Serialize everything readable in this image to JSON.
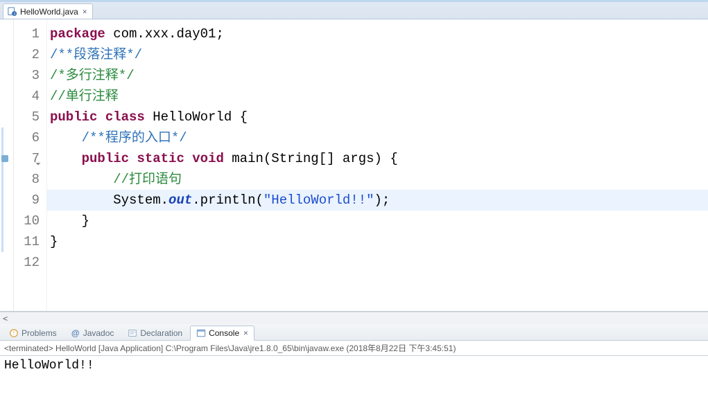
{
  "editor": {
    "tab": {
      "filename": "HelloWorld.java",
      "close_glyph": "✕"
    },
    "highlighted_line": 9,
    "fold_ranges": [
      [
        6,
        11
      ]
    ],
    "override_marker_line": 7,
    "lines": [
      {
        "n": 1,
        "tokens": [
          {
            "t": "package",
            "c": "kw"
          },
          {
            "t": " com.xxx.day01;",
            "c": ""
          }
        ]
      },
      {
        "n": 2,
        "tokens": [
          {
            "t": "/**段落注释*/",
            "c": "cm1"
          }
        ]
      },
      {
        "n": 3,
        "tokens": [
          {
            "t": "/*多行注释*/",
            "c": "cm2"
          }
        ]
      },
      {
        "n": 4,
        "tokens": [
          {
            "t": "//单行注释",
            "c": "cm2"
          }
        ]
      },
      {
        "n": 5,
        "tokens": [
          {
            "t": "public",
            "c": "kw"
          },
          {
            "t": " ",
            "c": ""
          },
          {
            "t": "class",
            "c": "kw"
          },
          {
            "t": " HelloWorld {",
            "c": ""
          }
        ]
      },
      {
        "n": 6,
        "indent": 1,
        "tokens": [
          {
            "t": "/**程序的入口*/",
            "c": "cm1"
          }
        ]
      },
      {
        "n": 7,
        "indent": 1,
        "tokens": [
          {
            "t": "public",
            "c": "kw"
          },
          {
            "t": " ",
            "c": ""
          },
          {
            "t": "static",
            "c": "kw"
          },
          {
            "t": " ",
            "c": ""
          },
          {
            "t": "void",
            "c": "kw"
          },
          {
            "t": " main(String[] args) {",
            "c": ""
          }
        ]
      },
      {
        "n": 8,
        "indent": 2,
        "tokens": [
          {
            "t": "//打印语句",
            "c": "cm2"
          }
        ]
      },
      {
        "n": 9,
        "indent": 2,
        "tokens": [
          {
            "t": "System.",
            "c": ""
          },
          {
            "t": "out",
            "c": "fld"
          },
          {
            "t": ".println(",
            "c": ""
          },
          {
            "t": "\"HelloWorld!!\"",
            "c": "str"
          },
          {
            "t": ");",
            "c": ""
          }
        ]
      },
      {
        "n": 10,
        "indent": 1,
        "tokens": [
          {
            "t": "}",
            "c": ""
          }
        ]
      },
      {
        "n": 11,
        "tokens": [
          {
            "t": "}",
            "c": ""
          }
        ]
      },
      {
        "n": 12,
        "tokens": []
      }
    ],
    "hscroll_left_glyph": "<"
  },
  "views": {
    "tabs": [
      {
        "id": "problems",
        "label": "Problems",
        "icon": "problems-icon"
      },
      {
        "id": "javadoc",
        "label": "Javadoc",
        "icon": "javadoc-icon"
      },
      {
        "id": "declaration",
        "label": "Declaration",
        "icon": "declaration-icon"
      },
      {
        "id": "console",
        "label": "Console",
        "icon": "console-icon",
        "close_glyph": "✕"
      }
    ],
    "active": "console"
  },
  "console": {
    "status": "<terminated> HelloWorld [Java Application] C:\\Program Files\\Java\\jre1.8.0_65\\bin\\javaw.exe (2018年8月22日 下午3:45:51)",
    "output": "HelloWorld!!"
  }
}
